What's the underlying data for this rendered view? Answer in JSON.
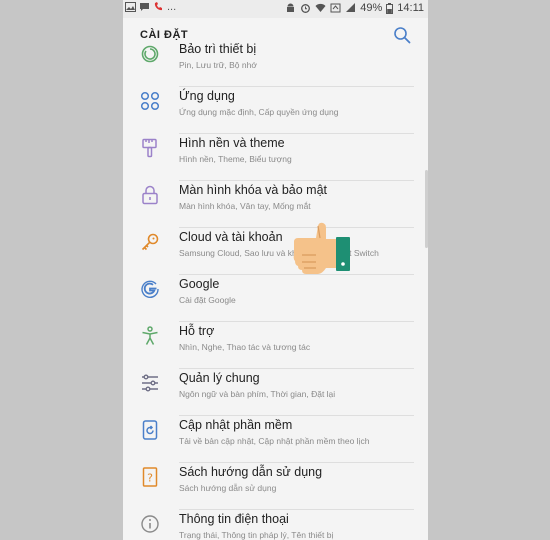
{
  "statusbar": {
    "battery_percent": "49%",
    "time": "14:11",
    "dots": "..."
  },
  "appbar": {
    "title": "CÀI ĐẶT"
  },
  "items": [
    {
      "title": "Bảo trì thiết bị",
      "subtitle": "Pin, Lưu trữ, Bộ nhớ",
      "icon": "device-maintenance-icon"
    },
    {
      "title": "Ứng dụng",
      "subtitle": "Ứng dụng mặc định, Cấp quyền ứng dụng",
      "icon": "apps-grid-icon"
    },
    {
      "title": "Hình nền và theme",
      "subtitle": "Hình nền, Theme, Biểu tượng",
      "icon": "paintbrush-icon"
    },
    {
      "title": "Màn hình khóa và bảo mật",
      "subtitle": "Màn hình khóa, Vân tay, Mống mắt",
      "icon": "lock-icon"
    },
    {
      "title": "Cloud và tài khoản",
      "subtitle": "Samsung Cloud, Sao lưu và khôi phục, Smart Switch",
      "icon": "key-icon"
    },
    {
      "title": "Google",
      "subtitle": "Cài đặt Google",
      "icon": "google-icon"
    },
    {
      "title": "Hỗ trợ",
      "subtitle": "Nhìn, Nghe, Thao tác và tương tác",
      "icon": "accessibility-icon"
    },
    {
      "title": "Quản lý chung",
      "subtitle": "Ngôn ngữ và bàn phím, Thời gian, Đặt lại",
      "icon": "sliders-icon"
    },
    {
      "title": "Cập nhật phần mềm",
      "subtitle": "Tải về bản cập nhật, Cập nhật phần mềm theo lịch",
      "icon": "software-update-icon"
    },
    {
      "title": "Sách hướng dẫn sử dụng",
      "subtitle": "Sách hướng dẫn sử dụng",
      "icon": "user-manual-icon"
    },
    {
      "title": "Thông tin điện thoại",
      "subtitle": "Trạng thái, Thông tin pháp lý, Tên thiết bị",
      "icon": "info-icon"
    }
  ],
  "colors": {
    "accent": "#4a7fc9",
    "icon_green": "#5ea86a",
    "icon_purple": "#9b82c9",
    "icon_orange": "#e0892a",
    "hand_skin": "#f5c28a",
    "hand_cuff": "#1e8f73"
  }
}
